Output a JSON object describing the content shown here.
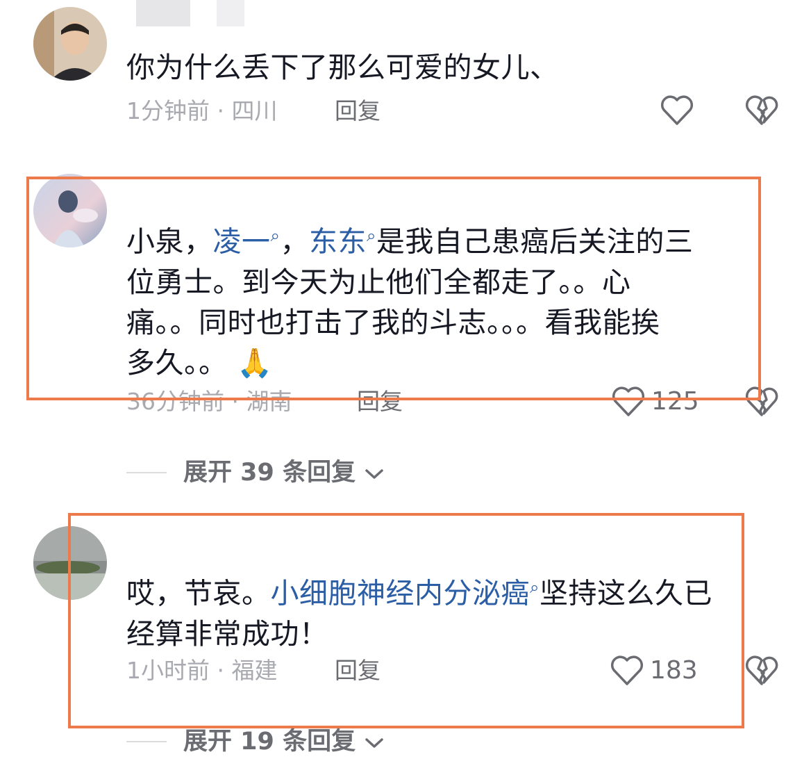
{
  "colors": {
    "highlight_box": "#ed7a4b",
    "link": "#2c5ea6",
    "meta": "#a9aab0"
  },
  "comments": [
    {
      "text_parts": [
        "你为什么丢下了那么可爱的女儿、"
      ],
      "time_location": "1分钟前 · 四川",
      "reply_label": "回复",
      "like_count": ""
    },
    {
      "text_prefix": "小泉，",
      "link1": "凌一",
      "sep": "，",
      "link2": "东东",
      "line1_rest": "是我自己患癌后关注的三",
      "line2": "位勇士。到今天为止他们全都走了。。心",
      "line3": "痛。。同时也打击了我的斗志。。。看我能挨",
      "line4": "多久。。",
      "time_location": "36分钟前 · 湖南",
      "reply_label": "回复",
      "like_count": "125",
      "expand_label": "展开 39 条回复"
    },
    {
      "text_prefix": "哎，节哀。",
      "link1": "小细胞神经内分泌癌",
      "line1_rest": "坚持这么久已",
      "line2": "经算非常成功！",
      "time_location": "1小时前 · 福建",
      "reply_label": "回复",
      "like_count": "183",
      "expand_label": "展开 19 条回复"
    }
  ],
  "icons": {
    "search_mark": "⌕",
    "pray_emoji": "🙏",
    "chevron": "chevron-down-icon",
    "like": "heart-outline-icon",
    "dislike": "broken-heart-icon"
  }
}
